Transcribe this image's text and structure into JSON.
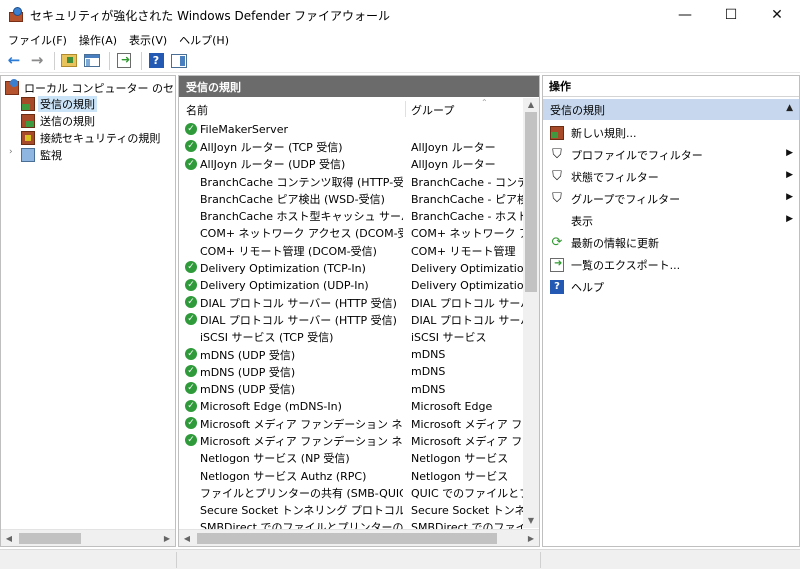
{
  "window": {
    "title": "セキュリティが強化された Windows Defender ファイアウォール",
    "minimize": "—",
    "maximize": "☐",
    "close": "✕"
  },
  "menu": [
    "ファイル(F)",
    "操作(A)",
    "表示(V)",
    "ヘルプ(H)"
  ],
  "toolbar": {
    "back_icon": "←",
    "forward_icon": "→",
    "help_label": "?"
  },
  "tree": {
    "root_label": "ローカル コンピューター のセキュリティが",
    "items": [
      {
        "label": "受信の規則",
        "icon": "inbound-rules-icon"
      },
      {
        "label": "送信の規則",
        "icon": "outbound-rules-icon"
      },
      {
        "label": "接続セキュリティの規則",
        "icon": "connection-security-icon"
      },
      {
        "label": "監視",
        "icon": "monitor-icon"
      }
    ],
    "expander": "›"
  },
  "list": {
    "header": "受信の規則",
    "col_name": "名前",
    "col_group": "グループ",
    "sort_caret": "⌃",
    "rows": [
      {
        "name": "FileMakerServer",
        "group": "",
        "enabled": true
      },
      {
        "name": "AllJoyn ルーター (TCP 受信)",
        "group": "AllJoyn ルーター",
        "enabled": true
      },
      {
        "name": "AllJoyn ルーター (UDP 受信)",
        "group": "AllJoyn ルーター",
        "enabled": true
      },
      {
        "name": "BranchCache コンテンツ取得 (HTTP-受信)",
        "group": "BranchCache - コンテンツ",
        "enabled": false
      },
      {
        "name": "BranchCache ピア検出 (WSD-受信)",
        "group": "BranchCache - ピア検出",
        "enabled": false
      },
      {
        "name": "BranchCache ホスト型キャッシュ サーバー (HTT...",
        "group": "BranchCache - ホスト型キ",
        "enabled": false
      },
      {
        "name": "COM+ ネットワーク アクセス (DCOM-受信)",
        "group": "COM+ ネットワーク アクセ",
        "enabled": false
      },
      {
        "name": "COM+ リモート管理 (DCOM-受信)",
        "group": "COM+ リモート管理",
        "enabled": false
      },
      {
        "name": "Delivery Optimization (TCP-In)",
        "group": "Delivery Optimization",
        "enabled": true
      },
      {
        "name": "Delivery Optimization (UDP-In)",
        "group": "Delivery Optimization",
        "enabled": true
      },
      {
        "name": "DIAL プロトコル サーバー (HTTP 受信)",
        "group": "DIAL プロトコル サーバー",
        "enabled": true
      },
      {
        "name": "DIAL プロトコル サーバー (HTTP 受信)",
        "group": "DIAL プロトコル サーバー",
        "enabled": true
      },
      {
        "name": "iSCSI サービス (TCP 受信)",
        "group": "iSCSI サービス",
        "enabled": false
      },
      {
        "name": "mDNS (UDP 受信)",
        "group": "mDNS",
        "enabled": true
      },
      {
        "name": "mDNS (UDP 受信)",
        "group": "mDNS",
        "enabled": true
      },
      {
        "name": "mDNS (UDP 受信)",
        "group": "mDNS",
        "enabled": true
      },
      {
        "name": "Microsoft Edge (mDNS-In)",
        "group": "Microsoft Edge",
        "enabled": true
      },
      {
        "name": "Microsoft メディア ファンデーション ネットワーク ...",
        "group": "Microsoft メディア ファンデ",
        "enabled": true
      },
      {
        "name": "Microsoft メディア ファンデーション ネットワーク ...",
        "group": "Microsoft メディア ファンデ",
        "enabled": true
      },
      {
        "name": "Netlogon サービス (NP 受信)",
        "group": "Netlogon サービス",
        "enabled": false
      },
      {
        "name": "Netlogon サービス Authz (RPC)",
        "group": "Netlogon サービス",
        "enabled": false
      },
      {
        "name": "ファイルとプリンターの共有 (SMB-QUIC 受信)",
        "group": "QUIC でのファイルとプリンタ",
        "enabled": false
      },
      {
        "name": "Secure Socket トンネリング プロトコル (SSTP 受...",
        "group": "Secure Socket トンネリング",
        "enabled": false
      },
      {
        "name": "SMBDirect でのファイルとプリンターの共有 (iW...",
        "group": "SMBDirect でのファイルと",
        "enabled": false
      }
    ]
  },
  "actions": {
    "header": "操作",
    "section": "受信の規則",
    "collapse": "▲",
    "items": [
      {
        "label": "新しい規則...",
        "icon": "new-rule-icon",
        "submenu": false
      },
      {
        "label": "プロファイルでフィルター",
        "icon": "filter-icon",
        "submenu": true
      },
      {
        "label": "状態でフィルター",
        "icon": "filter-icon",
        "submenu": true
      },
      {
        "label": "グループでフィルター",
        "icon": "filter-icon",
        "submenu": true
      },
      {
        "label": "表示",
        "icon": "",
        "submenu": true
      },
      {
        "label": "最新の情報に更新",
        "icon": "refresh-icon",
        "submenu": false
      },
      {
        "label": "一覧のエクスポート...",
        "icon": "export-icon",
        "submenu": false
      },
      {
        "label": "ヘルプ",
        "icon": "help-icon",
        "submenu": false
      }
    ],
    "submenu_arrow": "▶"
  }
}
